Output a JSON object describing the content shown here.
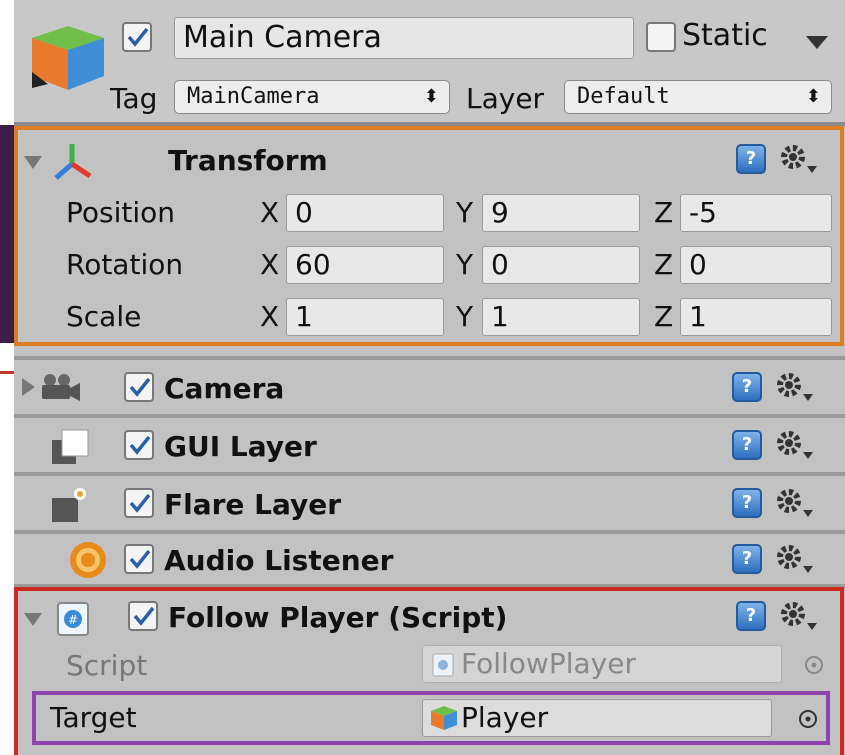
{
  "object": {
    "name": "Main Camera",
    "active": true,
    "static_label": "Static",
    "static_checked": false,
    "tag_label": "Tag",
    "tag_value": "MainCamera",
    "layer_label": "Layer",
    "layer_value": "Default"
  },
  "transform": {
    "title": "Transform",
    "rows": [
      {
        "label": "Position",
        "x": "0",
        "y": "9",
        "z": "-5"
      },
      {
        "label": "Rotation",
        "x": "60",
        "y": "0",
        "z": "0"
      },
      {
        "label": "Scale",
        "x": "1",
        "y": "1",
        "z": "1"
      }
    ],
    "axis_x": "X",
    "axis_y": "Y",
    "axis_z": "Z"
  },
  "components": [
    {
      "name": "Camera",
      "enabled": true,
      "icon": "camera-icon"
    },
    {
      "name": "GUI Layer",
      "enabled": true,
      "icon": "gui-layer-icon"
    },
    {
      "name": "Flare Layer",
      "enabled": true,
      "icon": "flare-layer-icon"
    },
    {
      "name": "Audio Listener",
      "enabled": true,
      "icon": "audio-listener-icon"
    }
  ],
  "script": {
    "title": "Follow Player (Script)",
    "enabled": true,
    "script_label": "Script",
    "script_value": "FollowPlayer",
    "target_label": "Target",
    "target_value": "Player"
  },
  "colors": {
    "transform_highlight": "#e07a1f",
    "script_highlight": "#cc2a1e",
    "target_highlight": "#8e44ad"
  }
}
